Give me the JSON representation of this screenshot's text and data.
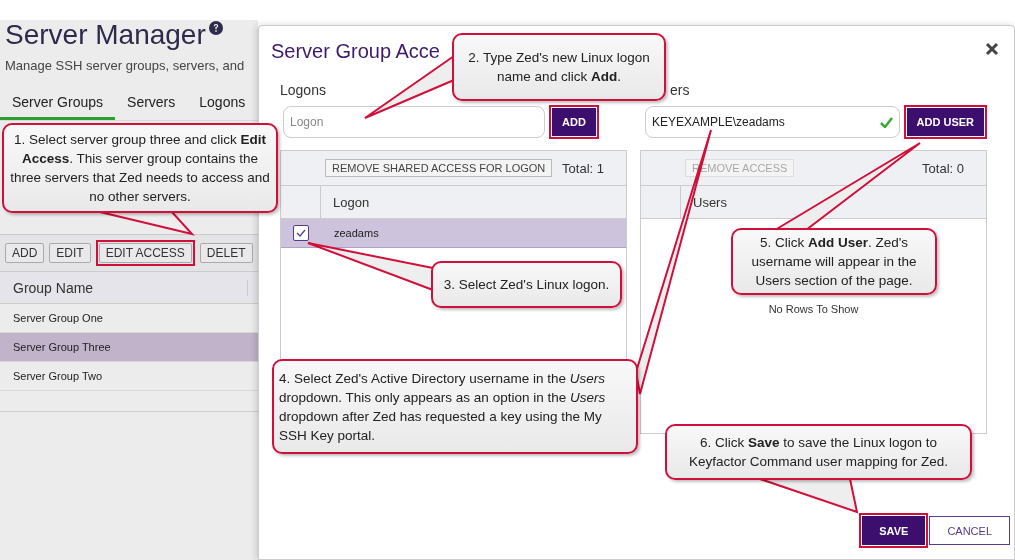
{
  "page": {
    "title": "Server Manager",
    "subtitle": "Manage SSH server groups, servers, and",
    "tabs": [
      {
        "label": "Server Groups",
        "selected": true
      },
      {
        "label": "Servers",
        "selected": false
      },
      {
        "label": "Logons",
        "selected": false
      }
    ],
    "toolbar": [
      {
        "label": "ADD",
        "highlighted": false
      },
      {
        "label": "EDIT",
        "highlighted": false
      },
      {
        "label": "EDIT ACCESS",
        "highlighted": true
      },
      {
        "label": "DELET",
        "highlighted": false
      }
    ],
    "grid": {
      "columns": [
        "Group Name"
      ],
      "rows": [
        {
          "name": "Server Group One",
          "selected": false
        },
        {
          "name": "Server Group Three",
          "selected": true
        },
        {
          "name": "Server Group Two",
          "selected": false
        }
      ]
    }
  },
  "modal": {
    "title": "Server Group Acce",
    "logons": {
      "label": "Logons",
      "input": {
        "placeholder": "Logon"
      },
      "add_button": {
        "label": "ADD",
        "highlighted": true
      },
      "remove_button": {
        "label": "REMOVE SHARED ACCESS FOR LOGON",
        "disabled": false
      },
      "total": "Total: 1",
      "columns": [
        "Logon"
      ],
      "rows": [
        {
          "logon": "zeadams",
          "checked": true,
          "selected": true
        }
      ]
    },
    "users": {
      "label": "ers",
      "input": {
        "value": "KEYEXAMPLE\\zeadams",
        "valid": true
      },
      "add_button": {
        "label": "ADD USER",
        "highlighted": true
      },
      "remove_button": {
        "label": "REMOVE ACCESS",
        "disabled": true
      },
      "total": "Total: 0",
      "columns": [
        "Users"
      ],
      "empty_text": "No Rows To Show"
    },
    "footer": [
      {
        "label": "SAVE",
        "kind": "primary",
        "highlighted": true
      },
      {
        "label": "CANCEL",
        "kind": "secondary",
        "highlighted": false
      }
    ]
  },
  "callouts": [
    {
      "text": "1. Select server group three and click **Edit Access**. This server group contains the three servers that Zed needs to access and no other servers."
    },
    {
      "text": "2. Type Zed's new Linux logon name and click **Add**."
    },
    {
      "text": "3. Select Zed's Linux logon."
    },
    {
      "text": "4. Select Zed's Active Directory username in the *Users* dropdown. This only appears as an option in the *Users* dropdown after Zed has requested a key using the My SSH Key portal."
    },
    {
      "text": "5. Click **Add User**. Zed's username will appear in the Users section of the page."
    },
    {
      "text": "6. Click **Save** to save the Linux logon to Keyfactor Command user mapping for Zed."
    }
  ]
}
